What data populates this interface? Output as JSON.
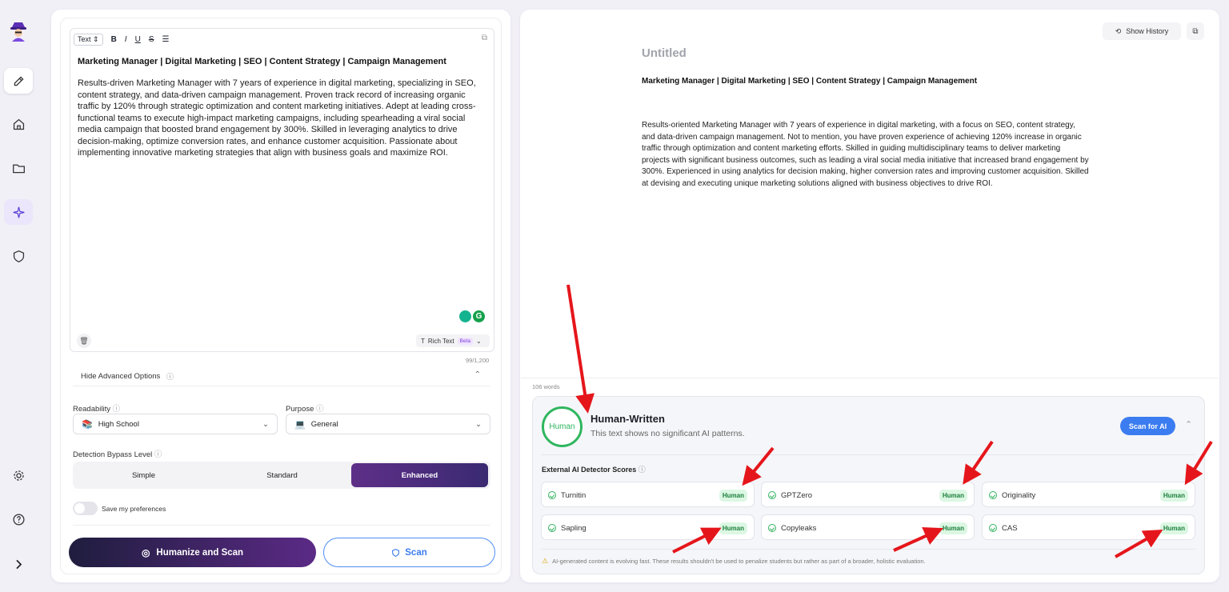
{
  "rail": {
    "items": [
      "logo-icon",
      "edit-icon",
      "home-icon",
      "folder-icon",
      "sparkle-icon",
      "shield-icon",
      "settings-icon",
      "help-icon",
      "expand-icon"
    ]
  },
  "editor": {
    "format_select": "Text",
    "heading": "Marketing Manager | Digital Marketing | SEO | Content Strategy | Campaign Management",
    "body": "Results-driven Marketing Manager with 7 years of experience in digital marketing, specializing in SEO, content strategy, and data-driven campaign management. Proven track record of increasing organic traffic by 120% through strategic optimization and content marketing initiatives. Adept at leading cross-functional teams to execute high-impact marketing campaigns, including spearheading a viral social media campaign that boosted brand engagement by 300%. Skilled in leveraging analytics to drive decision-making, optimize conversion rates, and enhance customer acquisition. Passionate about implementing innovative marketing strategies that align with business goals and maximize ROI.",
    "rich_text_label": "Rich Text",
    "beta_badge": "Beta",
    "char_count": "99/1,200"
  },
  "options": {
    "toggle_label": "Hide Advanced Options",
    "readability_label": "Readability",
    "readability_value": "High School",
    "purpose_label": "Purpose",
    "purpose_value": "General",
    "bypass_label": "Detection Bypass Level",
    "levels": [
      "Simple",
      "Standard",
      "Enhanced"
    ],
    "selected_level": "Enhanced",
    "save_prefs_label": "Save my preferences"
  },
  "actions": {
    "humanize_label": "Humanize and Scan",
    "scan_label": "Scan"
  },
  "output": {
    "show_history_label": "Show History",
    "title": "Untitled",
    "heading": "Marketing Manager | Digital Marketing | SEO | Content Strategy | Campaign Management",
    "body": "Results-oriented Marketing Manager with 7 years of experience in digital marketing, with a focus  on SEO, content strategy, and data-driven campaign management. Not to mention, you have proven  experience of achieving 120% increase in organic traffic through optimization and content marketing efforts. Skilled in guiding multidisciplinary teams to deliver marketing projects with significant business outcomes, such  as leading a viral social media initiative that increased brand engagement by 300%. Experienced in  using analytics for decision making, higher conversion rates and improving customer acquisition. Skilled at devising and executing unique marketing solutions aligned with business objectives  to drive ROI.",
    "word_count": "106 words"
  },
  "result": {
    "ring_label": "Human",
    "title": "Human-Written",
    "subtitle": "This text shows no significant AI patterns.",
    "scan_ai_label": "Scan for AI",
    "detectors_heading": "External AI Detector Scores",
    "detectors": [
      {
        "name": "Turnitin",
        "verdict": "Human"
      },
      {
        "name": "GPTZero",
        "verdict": "Human"
      },
      {
        "name": "Originality",
        "verdict": "Human"
      },
      {
        "name": "Sapling",
        "verdict": "Human"
      },
      {
        "name": "Copyleaks",
        "verdict": "Human"
      },
      {
        "name": "CAS",
        "verdict": "Human"
      }
    ],
    "disclaimer": "AI-generated content is evolving fast. These results shouldn't be used to penalize students but rather as part of a broader, holistic evaluation."
  },
  "colors": {
    "accent": "#3b7cf0",
    "human_green": "#2fb65f",
    "annotation_red": "#e5161b",
    "enhanced": "#4a2d7d"
  }
}
